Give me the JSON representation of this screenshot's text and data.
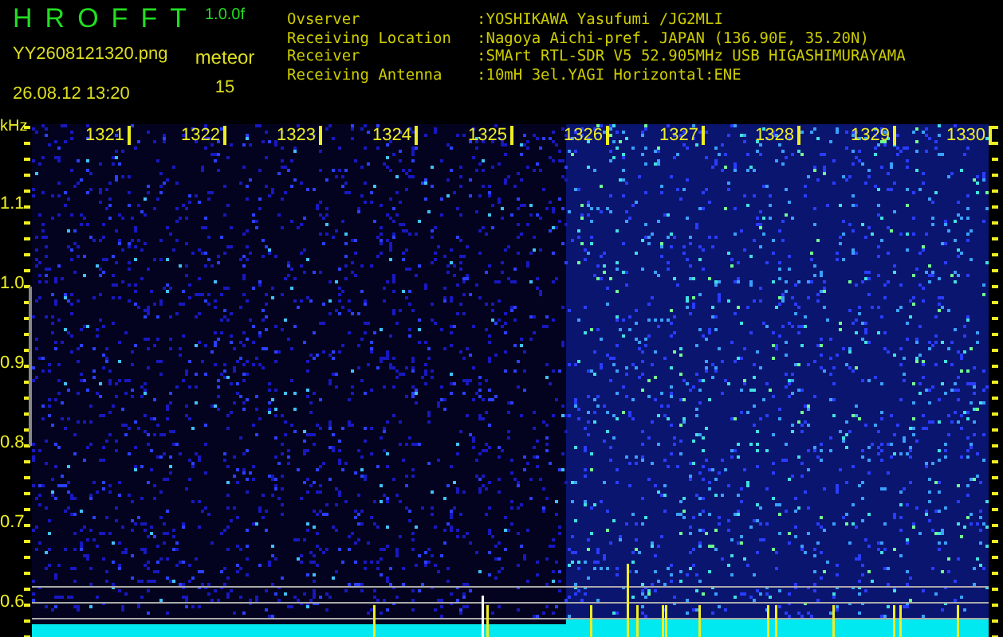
{
  "header": {
    "title_letters": [
      "H",
      "R",
      "O",
      "F",
      "F",
      "T"
    ],
    "version": "1.0.0f",
    "filename": "YY2608121320.png",
    "timestamp": "26.08.12 13:20",
    "meteor_label": "meteor",
    "meteor_count": "15"
  },
  "info": [
    {
      "label": "Ovserver",
      "value": ":YOSHIKAWA Yasufumi /JG2MLI"
    },
    {
      "label": "Receiving Location",
      "value": ":Nagoya Aichi-pref. JAPAN (136.90E, 35.20N)"
    },
    {
      "label": "Receiver",
      "value": ":SMArt RTL-SDR V5 52.905MHz USB HIGASHIMURAYAMA"
    },
    {
      "label": "Receiving Antenna",
      "value": ":10mH 3el.YAGI Horizontal:ENE"
    }
  ],
  "spectrogram": {
    "unit": "kHz",
    "time_labels": [
      "1321",
      "1322",
      "1323",
      "1324",
      "1325",
      "1326",
      "1327",
      "1328",
      "1329",
      "1330"
    ],
    "freq_labels": [
      "1.1",
      "1.0",
      "0.9",
      "0.8",
      "0.7",
      "0.6"
    ]
  }
}
